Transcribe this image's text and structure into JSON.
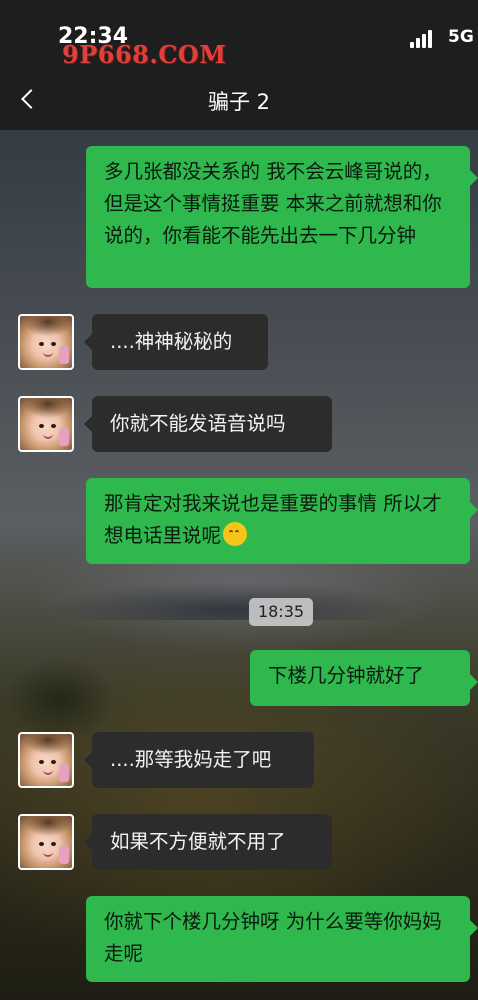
{
  "status_bar": {
    "time": "22:34",
    "network": "5G",
    "watermark": "9P668.COM"
  },
  "header": {
    "title": "骗子 2"
  },
  "messages": [
    {
      "side": "out",
      "text": "多几张都没关系的 我不会云峰哥说的，但是这个事情挺重要 本来之前就想和你说的，你看能不能先出去一下几分钟"
    },
    {
      "side": "in",
      "text": "....神神秘秘的"
    },
    {
      "side": "in",
      "text": "你就不能发语音说吗"
    },
    {
      "side": "out",
      "text": "那肯定对我来说也是重要的事情 所以才想电话里说呢",
      "emoji": "thinking-face-icon"
    },
    {
      "side": "out",
      "text": "下楼几分钟就好了"
    },
    {
      "side": "in",
      "text": "....那等我妈走了吧"
    },
    {
      "side": "in",
      "text": "如果不方便就不用了"
    },
    {
      "side": "out",
      "text": "你就下个楼几分钟呀 为什么要等你妈妈走呢"
    }
  ],
  "timestamp": "18:35",
  "colors": {
    "outgoing_bubble": "#2fb84e",
    "incoming_bubble": "#2c2c2c",
    "header_bg": "#1e1e1e",
    "watermark": "#e0403a"
  }
}
